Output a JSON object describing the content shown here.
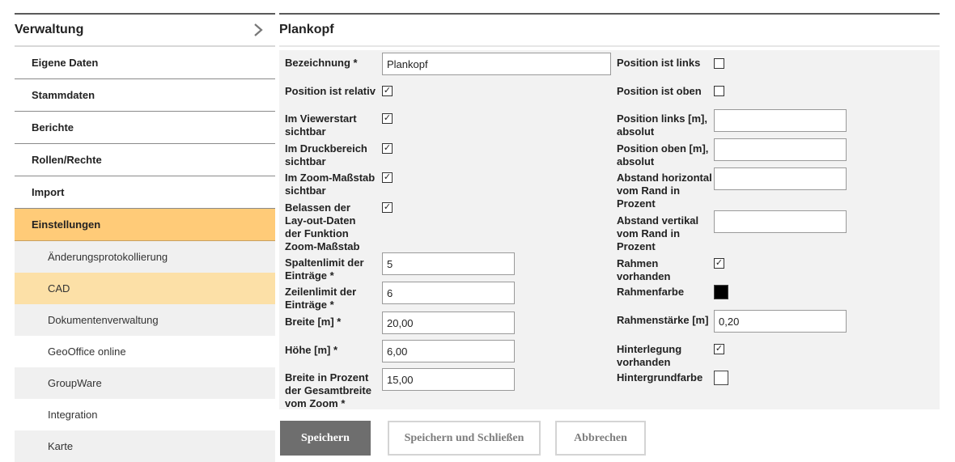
{
  "sidebar": {
    "title": "Verwaltung",
    "expand_icon": "chevron-right-icon",
    "items": [
      {
        "label": "Eigene Daten"
      },
      {
        "label": "Stammdaten"
      },
      {
        "label": "Berichte"
      },
      {
        "label": "Rollen/Rechte"
      },
      {
        "label": "Import"
      },
      {
        "label": "Einstellungen",
        "active": true
      }
    ],
    "subitems": [
      {
        "label": "Änderungsprotokollierung"
      },
      {
        "label": "CAD",
        "active": true
      },
      {
        "label": "Dokumentenverwaltung"
      },
      {
        "label": "GeoOffice online"
      },
      {
        "label": "GroupWare"
      },
      {
        "label": "Integration"
      },
      {
        "label": "Karte"
      }
    ]
  },
  "main": {
    "title": "Plankopf"
  },
  "form": {
    "left": {
      "bezeichnung": {
        "label": "Bezeichnung *",
        "value": "Plankopf"
      },
      "position_relativ": {
        "label": "Position ist relativ",
        "checked": true
      },
      "viewerstart": {
        "label": "Im Viewerstart sichtbar",
        "checked": true
      },
      "druckbereich": {
        "label": "Im Druckbereich sichtbar",
        "checked": true
      },
      "zoom_massstab": {
        "label": "Im Zoom-Maßstab sichtbar",
        "checked": true
      },
      "belassen": {
        "label": "Belassen der Lay-out-Daten der Funktion Zoom-Maßstab",
        "checked": true
      },
      "spaltenlimit": {
        "label": "Spaltenlimit der Einträge *",
        "value": "5"
      },
      "zeilenlimit": {
        "label": "Zeilenlimit der Einträge *",
        "value": "6"
      },
      "breite": {
        "label": "Breite [m] *",
        "value": "20,00"
      },
      "hoehe": {
        "label": "Höhe [m] *",
        "value": "6,00"
      },
      "breite_prozent": {
        "label": "Breite in Prozent der Gesamtbreite vom Zoom *",
        "value": "15,00"
      }
    },
    "right": {
      "position_links": {
        "label": "Position ist links",
        "checked": false
      },
      "position_oben": {
        "label": "Position ist oben",
        "checked": false
      },
      "pos_links_abs": {
        "label": "Position links [m], absolut",
        "value": ""
      },
      "pos_oben_abs": {
        "label": "Position oben [m], absolut",
        "value": ""
      },
      "abstand_horizontal": {
        "label": "Abstand horizontal vom Rand in Prozent",
        "value": ""
      },
      "abstand_vertikal": {
        "label": "Abstand vertikal vom Rand in Prozent",
        "value": ""
      },
      "rahmen_vorhanden": {
        "label": "Rahmen vorhanden",
        "checked": true
      },
      "rahmenfarbe": {
        "label": "Rahmenfarbe",
        "color": "#000000"
      },
      "rahmenstaerke": {
        "label": "Rahmenstärke [m]",
        "value": "0,20"
      },
      "hinterlegung": {
        "label": "Hinterlegung vorhanden",
        "checked": true
      },
      "hintergrundfarbe": {
        "label": "Hintergrundfarbe",
        "color": "#ffffff"
      }
    }
  },
  "buttons": {
    "save": "Speichern",
    "save_close": "Speichern und Schließen",
    "cancel": "Abbrechen"
  },
  "colors": {
    "active_nav": "#ffcb78",
    "active_subnav": "#fce0a7",
    "primary_button": "#6e6e6e",
    "form_background": "#f2f2f2"
  }
}
